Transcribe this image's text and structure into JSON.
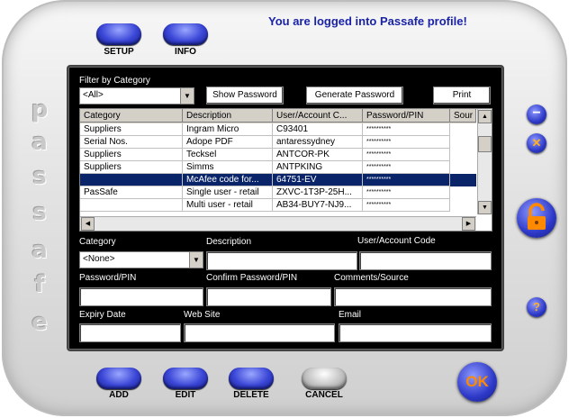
{
  "header": {
    "title": "You are logged into Passafe profile!"
  },
  "top_buttons": [
    {
      "label": "SETUP"
    },
    {
      "label": "INFO"
    }
  ],
  "brand_letters": [
    "p",
    "a",
    "s",
    "s",
    "a",
    "f",
    "e"
  ],
  "filter": {
    "label": "Filter by Category",
    "value": "<All>"
  },
  "toolbar": {
    "show_password": "Show Password",
    "generate_password": "Generate Password",
    "print": "Print"
  },
  "table": {
    "headers": [
      "Category",
      "Description",
      "User/Account C...",
      "Password/PIN",
      "Sour"
    ],
    "rows": [
      {
        "category": "Suppliers",
        "description": "Ingram Micro",
        "user": "C93401",
        "password": "**********"
      },
      {
        "category": "Serial Nos.",
        "description": "Adope PDF",
        "user": "antaressydney",
        "password": "**********"
      },
      {
        "category": "Suppliers",
        "description": "Tecksel",
        "user": "ANTCOR-PK",
        "password": "**********"
      },
      {
        "category": "Suppliers",
        "description": "Simms",
        "user": "ANTPKING",
        "password": "**********"
      },
      {
        "category": "",
        "description": "McAfee code for...",
        "user": "64751-EV",
        "password": "**********",
        "selected": true
      },
      {
        "category": "PasSafe",
        "description": "Single user - retail",
        "user": "ZXVC-1T3P-25H...",
        "password": "**********"
      },
      {
        "category": "",
        "description": "Multi user - retail",
        "user": "AB34-BUY7-NJ9...",
        "password": "**********"
      }
    ]
  },
  "form": {
    "category_label": "Category",
    "category_value": "<None>",
    "description_label": "Description",
    "user_code_label": "User/Account Code",
    "password_label": "Password/PIN",
    "confirm_password_label": "Confirm Password/PIN",
    "comments_label": "Comments/Source",
    "expiry_label": "Expiry Date",
    "website_label": "Web Site",
    "email_label": "Email"
  },
  "side": {
    "minimize_icon": "−",
    "close_icon": "✕",
    "help_icon": "?"
  },
  "bottom_buttons": [
    {
      "label": "ADD"
    },
    {
      "label": "EDIT"
    },
    {
      "label": "DELETE"
    },
    {
      "label": "CANCEL"
    }
  ],
  "ok_button": {
    "label": "OK"
  },
  "colors": {
    "title": "#1a23a8",
    "selection": "#0a246a",
    "accent_orange": "#ff8a00"
  }
}
